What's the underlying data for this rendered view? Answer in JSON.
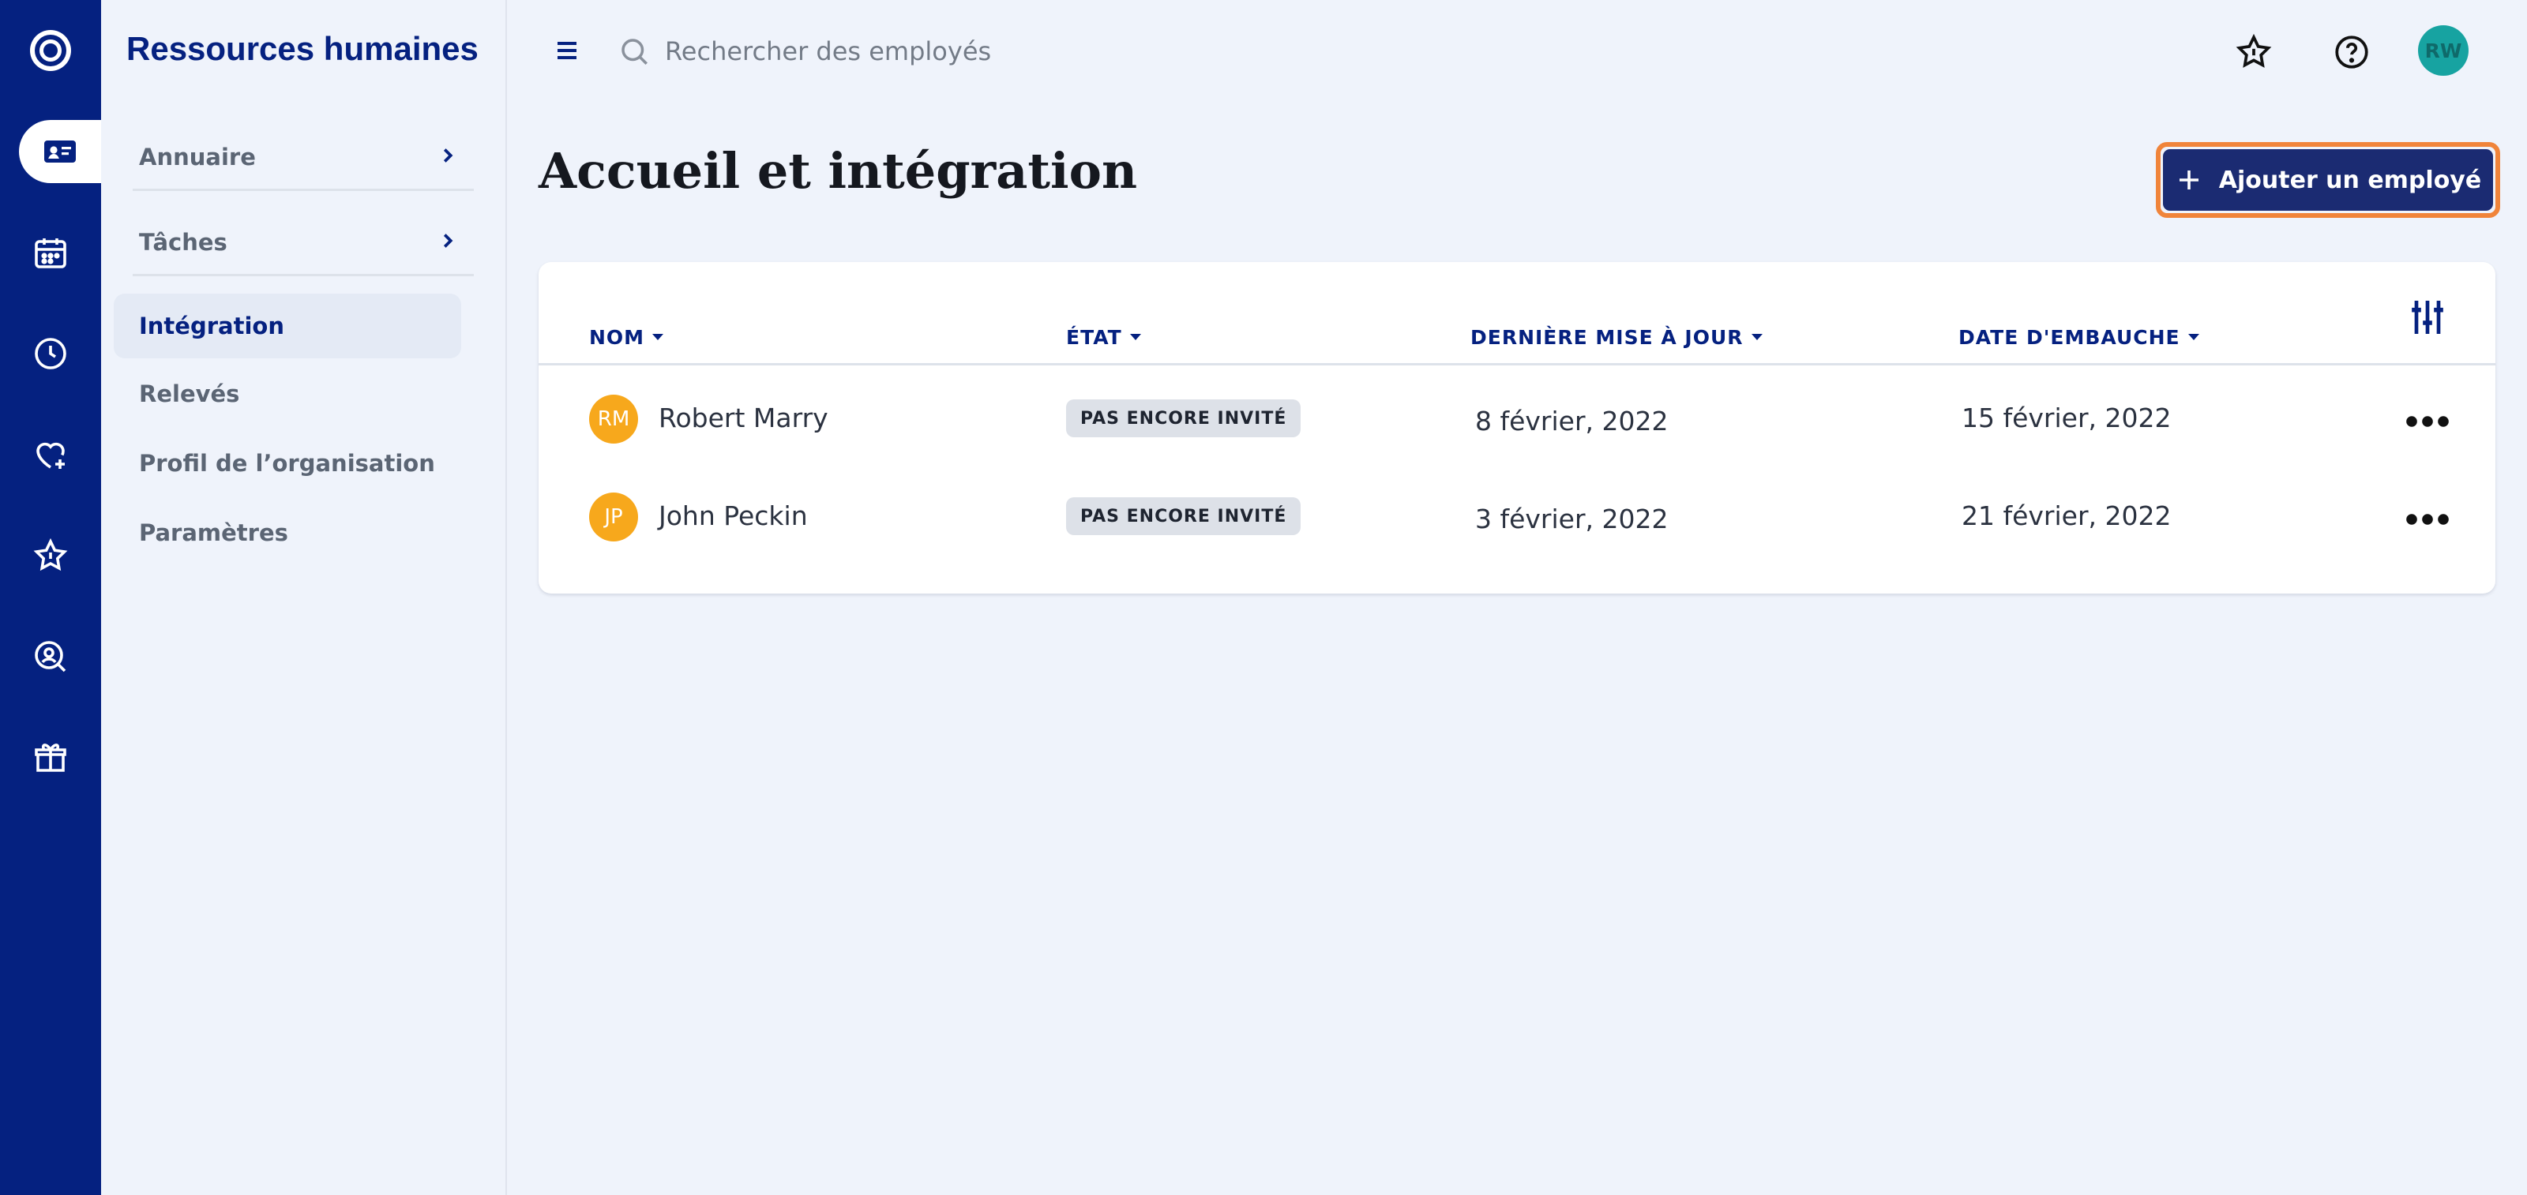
{
  "sidebar": {
    "app_title": "Ressources humaines",
    "items": [
      {
        "label": "Annuaire",
        "has_chevron": true
      },
      {
        "label": "Tâches",
        "has_chevron": true
      },
      {
        "label": "Intégration",
        "active": true
      },
      {
        "label": "Relevés"
      },
      {
        "label": "Profil de l’organisation"
      },
      {
        "label": "Paramètres"
      }
    ]
  },
  "rail": {
    "icons": [
      "logo-icon",
      "employee-card-icon",
      "calendar-icon",
      "clock-icon",
      "heart-plus-icon",
      "star-icon",
      "user-search-icon",
      "gift-box-icon"
    ],
    "active": "employee-card-icon"
  },
  "topbar": {
    "search_placeholder": "Rechercher des employés",
    "avatar_initials": "RW"
  },
  "page": {
    "title": "Accueil et intégration",
    "add_button_label": "Ajouter un employé"
  },
  "table": {
    "columns": [
      "NOM",
      "ÉTAT",
      "DERNIÈRE MISE À JOUR",
      "DATE D'EMBAUCHE"
    ],
    "rows": [
      {
        "initials": "RM",
        "name": "Robert Marry",
        "status": "PAS ENCORE INVITÉ",
        "updated": "8 février, 2022",
        "hired": "15 février, 2022"
      },
      {
        "initials": "JP",
        "name": "John Peckin",
        "status": "PAS ENCORE INVITÉ",
        "updated": "3 février, 2022",
        "hired": "21 février, 2022"
      }
    ]
  },
  "colors": {
    "rail_bg": "#052180",
    "primary_text": "#052180",
    "button_bg": "#1b2b72",
    "button_focus_ring": "#f0843a",
    "avatar_orange": "#f7a81c",
    "avatar_teal": "#17a3a1"
  }
}
